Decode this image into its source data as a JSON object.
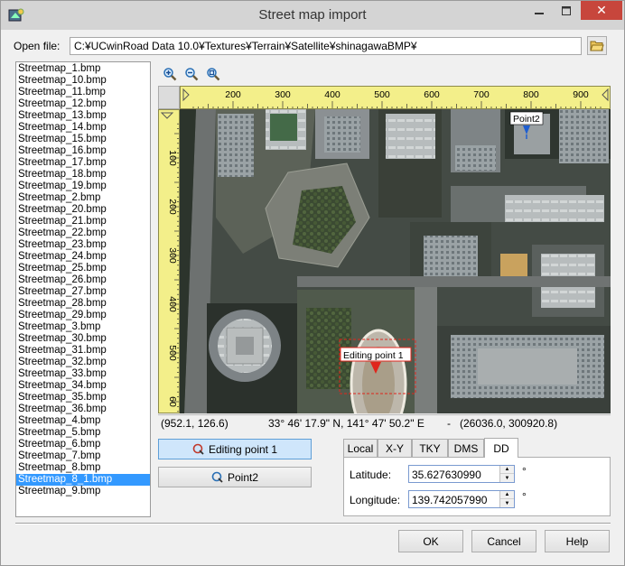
{
  "window": {
    "title": "Street map import"
  },
  "open_file": {
    "label": "Open file:",
    "path": "C:¥UCwinRoad Data 10.0¥Textures¥Terrain¥Satellite¥shinagawaBMP¥"
  },
  "files": [
    "Streetmap_1.bmp",
    "Streetmap_10.bmp",
    "Streetmap_11.bmp",
    "Streetmap_12.bmp",
    "Streetmap_13.bmp",
    "Streetmap_14.bmp",
    "Streetmap_15.bmp",
    "Streetmap_16.bmp",
    "Streetmap_17.bmp",
    "Streetmap_18.bmp",
    "Streetmap_19.bmp",
    "Streetmap_2.bmp",
    "Streetmap_20.bmp",
    "Streetmap_21.bmp",
    "Streetmap_22.bmp",
    "Streetmap_23.bmp",
    "Streetmap_24.bmp",
    "Streetmap_25.bmp",
    "Streetmap_26.bmp",
    "Streetmap_27.bmp",
    "Streetmap_28.bmp",
    "Streetmap_29.bmp",
    "Streetmap_3.bmp",
    "Streetmap_30.bmp",
    "Streetmap_31.bmp",
    "Streetmap_32.bmp",
    "Streetmap_33.bmp",
    "Streetmap_34.bmp",
    "Streetmap_35.bmp",
    "Streetmap_36.bmp",
    "Streetmap_4.bmp",
    "Streetmap_5.bmp",
    "Streetmap_6.bmp",
    "Streetmap_7.bmp",
    "Streetmap_8.bmp",
    "Streetmap_8_1.bmp",
    "Streetmap_9.bmp"
  ],
  "selected_file": "Streetmap_8_1.bmp",
  "ruler": {
    "h_ticks": [
      "200",
      "300",
      "400",
      "500",
      "600",
      "700",
      "800",
      "900"
    ],
    "v_ticks": [
      "100",
      "200",
      "300",
      "400",
      "500",
      "60"
    ]
  },
  "map": {
    "point2_label": "Point2",
    "editing_label": "Editing point 1"
  },
  "status": {
    "pixel": "(952.1, 126.6)",
    "geo": "33° 46' 17.9\" N, 141° 47' 50.2\" E",
    "sep": "-",
    "xy": "(26036.0, 300920.8)"
  },
  "points": {
    "editing_label": "Editing point 1",
    "point2_label": "Point2"
  },
  "tabs": [
    "Local",
    "X-Y",
    "TKY",
    "DMS",
    "DD"
  ],
  "active_tab": "DD",
  "dd": {
    "lat_label": "Latitude:",
    "lat_value": "35.627630990",
    "lon_label": "Longitude:",
    "lon_value": "139.742057990",
    "unit": "°"
  },
  "buttons": {
    "ok": "OK",
    "cancel": "Cancel",
    "help": "Help"
  },
  "colors": {
    "ruler": "#f3ef8a",
    "selection": "#3399ff",
    "marker_red": "#e0261c",
    "marker_blue": "#1f5fd1"
  }
}
